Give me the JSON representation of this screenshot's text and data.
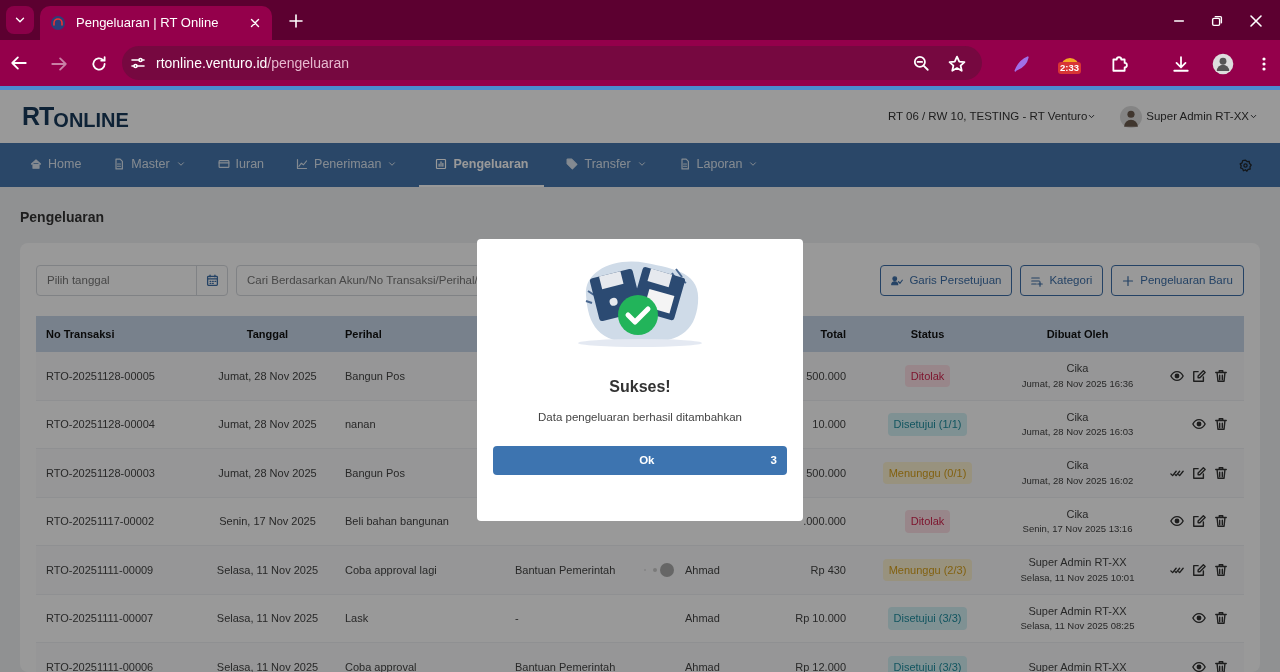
{
  "browser": {
    "tab_title": "Pengeluaran | RT Online",
    "url_host": "rtonline.venturo.id",
    "url_path": "/pengeluaran",
    "extension_badge": "2:33"
  },
  "header": {
    "logo_rt": "RT",
    "logo_online": "ONLINE",
    "location": "RT 06 / RW 10, TESTING - RT Venturo",
    "user": "Super Admin RT-XX"
  },
  "nav": [
    {
      "label": "Home",
      "dropdown": false,
      "selected": false
    },
    {
      "label": "Master",
      "dropdown": true,
      "selected": false
    },
    {
      "label": "Iuran",
      "dropdown": false,
      "selected": false
    },
    {
      "label": "Penerimaan",
      "dropdown": true,
      "selected": false
    },
    {
      "label": "Pengeluaran",
      "dropdown": false,
      "selected": true
    },
    {
      "label": "Transfer",
      "dropdown": true,
      "selected": false
    },
    {
      "label": "Laporan",
      "dropdown": true,
      "selected": false
    }
  ],
  "page_title": "Pengeluaran",
  "filters": {
    "date_placeholder": "Pilih tanggal",
    "search_placeholder": "Cari Berdasarkan Akun/No Transaksi/Perihal/"
  },
  "buttons": [
    {
      "label": "Garis Persetujuan"
    },
    {
      "label": "Kategori"
    },
    {
      "label": "Pengeluaran Baru"
    }
  ],
  "table": {
    "columns": {
      "no": "No Transaksi",
      "date": "Tanggal",
      "subject": "Perihal",
      "total": "Total",
      "status": "Status",
      "created_by": "Dibuat Oleh"
    },
    "rows": [
      {
        "no": "RTO-20251128-00005",
        "date": "Jumat, 28 Nov 2025",
        "subject": "Bangun Pos",
        "loading": false,
        "total": "500.000",
        "status": {
          "label": "Ditolak",
          "kind": "rejected"
        },
        "created_by": "Cika",
        "created_at": "Jumat, 28 Nov 2025 16:36",
        "actions": [
          {
            "kind": "view"
          },
          {
            "kind": "edit"
          },
          {
            "kind": "delete"
          }
        ]
      },
      {
        "no": "RTO-20251128-00004",
        "date": "Jumat, 28 Nov 2025",
        "subject": "nanan",
        "loading": false,
        "total": "10.000",
        "status": {
          "label": "Disetujui (1/1)",
          "kind": "approved"
        },
        "created_by": "Cika",
        "created_at": "Jumat, 28 Nov 2025 16:03",
        "actions": [
          {
            "kind": "view"
          },
          {
            "kind": "delete"
          }
        ]
      },
      {
        "no": "RTO-20251128-00003",
        "date": "Jumat, 28 Nov 2025",
        "subject": "Bangun Pos",
        "loading": false,
        "total": "500.000",
        "status": {
          "label": "Menunggu (0/1)",
          "kind": "pending"
        },
        "created_by": "Cika",
        "created_at": "Jumat, 28 Nov 2025 16:02",
        "actions": [
          {
            "kind": "approve"
          },
          {
            "kind": "edit"
          },
          {
            "kind": "delete"
          }
        ]
      },
      {
        "no": "RTO-20251117-00002",
        "date": "Senin, 17 Nov 2025",
        "subject": "Beli bahan bangunan",
        "loading": false,
        "total": ".000.000",
        "status": {
          "label": "Ditolak",
          "kind": "rejected"
        },
        "created_by": "Cika",
        "created_at": "Senin, 17 Nov 2025 13:16",
        "actions": [
          {
            "kind": "view"
          },
          {
            "kind": "edit"
          },
          {
            "kind": "delete"
          }
        ]
      },
      {
        "no": "RTO-20251111-00009",
        "date": "Selasa, 11 Nov 2025",
        "subject": "Coba approval lagi",
        "column_4": "Bantuan Pemerintah",
        "column_5": "Ahmad",
        "loading": true,
        "total": "Rp 430",
        "status": {
          "label": "Menunggu (2/3)",
          "kind": "pending"
        },
        "created_by": "Super Admin RT-XX",
        "created_at": "Selasa, 11 Nov 2025 10:01",
        "actions": [
          {
            "kind": "approve"
          },
          {
            "kind": "edit"
          },
          {
            "kind": "delete"
          }
        ]
      },
      {
        "no": "RTO-20251111-00007",
        "date": "Selasa, 11 Nov 2025",
        "subject": "Lask",
        "column_4": "-",
        "column_5": "Ahmad",
        "loading": false,
        "total": "Rp 10.000",
        "status": {
          "label": "Disetujui (3/3)",
          "kind": "approved"
        },
        "created_by": "Super Admin RT-XX",
        "created_at": "Selasa, 11 Nov 2025 08:25",
        "actions": [
          {
            "kind": "view"
          },
          {
            "kind": "delete"
          }
        ]
      },
      {
        "no": "RTO-20251111-00006",
        "date": "Selasa, 11 Nov 2025",
        "subject": "Coba approval",
        "column_4": "Bantuan Pemerintah",
        "column_5": "Ahmad",
        "loading": false,
        "total": "Rp 12.000",
        "status": {
          "label": "Disetujui (3/3)",
          "kind": "approved"
        },
        "created_by": "Super Admin RT-XX",
        "actions": [
          {
            "kind": "view"
          },
          {
            "kind": "delete"
          }
        ]
      }
    ]
  },
  "modal": {
    "title": "Sukses!",
    "message": "Data pengeluaran berhasil ditambahkan",
    "button": "Ok",
    "countdown": "3"
  }
}
